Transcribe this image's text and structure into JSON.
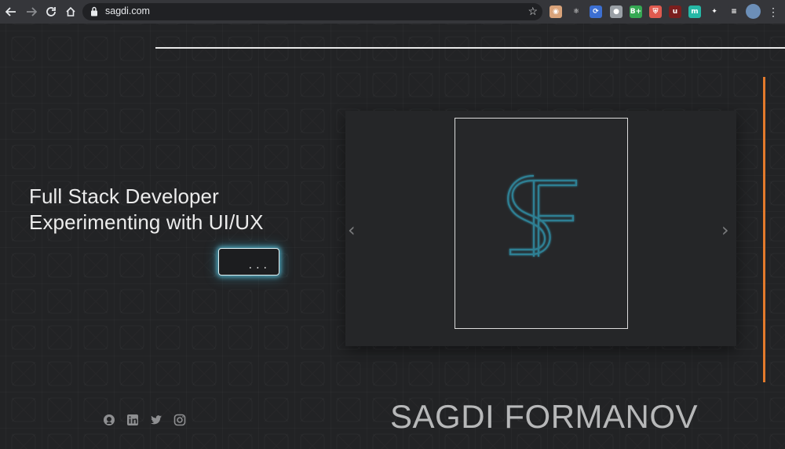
{
  "browser": {
    "url": "sagdi.com",
    "nav": {
      "back_icon": "arrow-left-icon",
      "forward_icon": "arrow-right-icon",
      "reload_icon": "reload-icon",
      "home_icon": "home-icon"
    },
    "extensions": [
      {
        "name": "ext-face-icon",
        "glyph": "◉",
        "color": "#d9a37a"
      },
      {
        "name": "ext-react-icon",
        "glyph": "⚛",
        "color": "#35363a"
      },
      {
        "name": "ext-refresh-icon",
        "glyph": "⟳",
        "color": "#3c6fd1"
      },
      {
        "name": "ext-badge-icon",
        "glyph": "●",
        "color": "#9aa0a6"
      },
      {
        "name": "ext-bplus-icon",
        "glyph": "B+",
        "color": "#35a853"
      },
      {
        "name": "ext-shield-icon",
        "glyph": "⛨",
        "color": "#e05a4f"
      },
      {
        "name": "ext-ublock-icon",
        "glyph": "u",
        "color": "#7a1e1e"
      },
      {
        "name": "ext-m-icon",
        "glyph": "m",
        "color": "#26b8a6"
      },
      {
        "name": "ext-puzzle-icon",
        "glyph": "✦",
        "color": "#35363a"
      },
      {
        "name": "ext-queue-icon",
        "glyph": "≡",
        "color": "#35363a"
      }
    ]
  },
  "hero": {
    "line1": "Full Stack Developer",
    "line2": "Experimenting with UI/UX",
    "more_button": "...",
    "accent_color": "#5cc4de",
    "orange_color": "#e27a2c"
  },
  "carousel": {
    "prev_icon": "chevron-left-icon",
    "next_icon": "chevron-right-icon",
    "logo_icon": "sf-monogram-logo"
  },
  "footer": {
    "socials": [
      "github-icon",
      "linkedin-icon",
      "twitter-icon",
      "instagram-icon"
    ],
    "name": "SAGDI FORMANOV"
  }
}
